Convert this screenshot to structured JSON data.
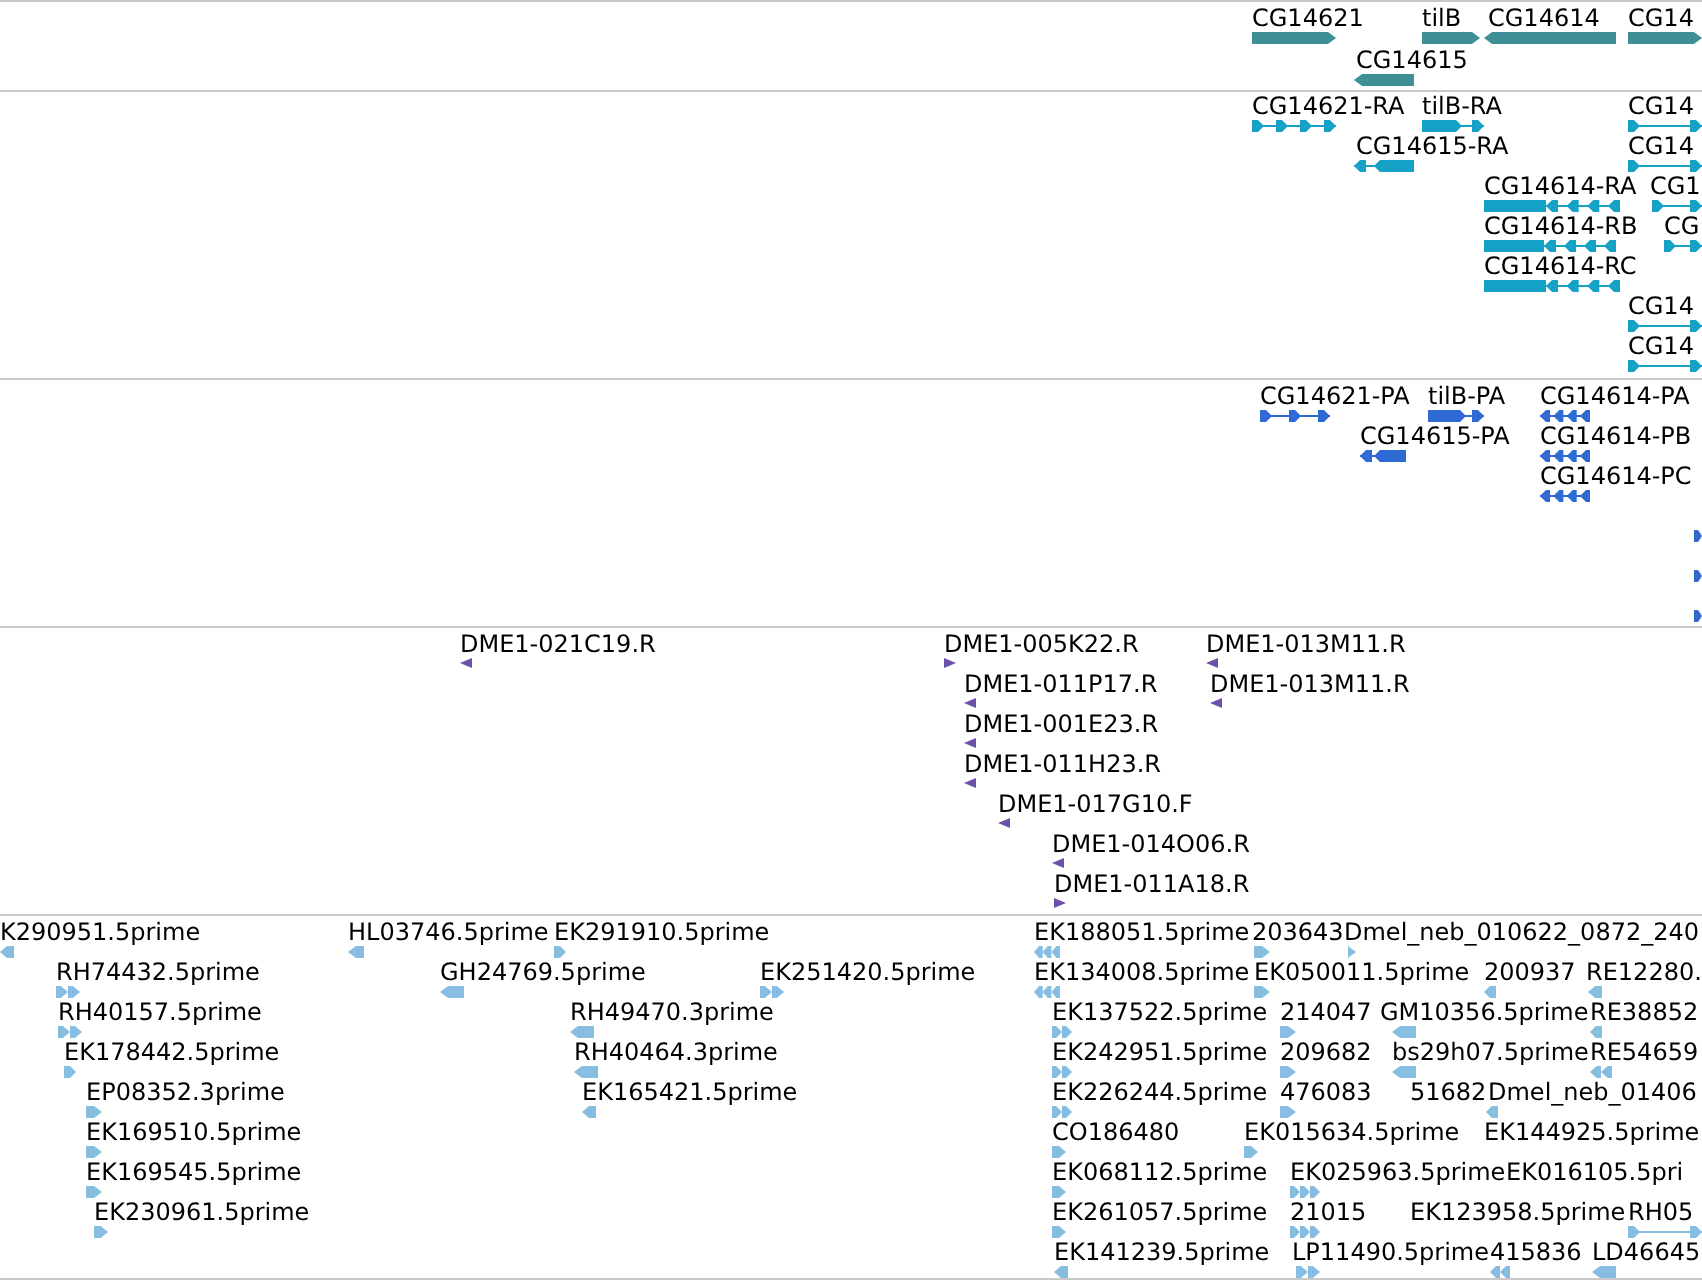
{
  "tracks": [
    {
      "kind": "gene",
      "features": [
        {
          "label": "CG14621",
          "reverse": false
        },
        {
          "label": "tilB",
          "reverse": false
        },
        {
          "label": "CG14614",
          "reverse": true
        },
        {
          "label": "CG14",
          "reverse": false
        },
        {
          "label": "CG14615",
          "reverse": true
        }
      ]
    },
    {
      "kind": "transcript",
      "features": [
        {
          "label": "CG14621-RA",
          "reverse": false
        },
        {
          "label": "tilB-RA",
          "reverse": false
        },
        {
          "label": "CG14",
          "reverse": false
        },
        {
          "label": "CG14615-RA",
          "reverse": true
        },
        {
          "label": "CG14",
          "reverse": false
        },
        {
          "label": "CG14614-RA",
          "reverse": true
        },
        {
          "label": "CG1",
          "reverse": false
        },
        {
          "label": "CG14614-RB",
          "reverse": true
        },
        {
          "label": "CG",
          "reverse": false
        },
        {
          "label": "CG14614-RC",
          "reverse": true
        },
        {
          "label": "CG14",
          "reverse": false
        },
        {
          "label": "CG14",
          "reverse": false
        }
      ]
    },
    {
      "kind": "protein",
      "features": [
        {
          "label": "CG14621-PA",
          "reverse": false
        },
        {
          "label": "tilB-PA",
          "reverse": false
        },
        {
          "label": "CG14614-PA",
          "reverse": true
        },
        {
          "label": "CG14615-PA",
          "reverse": true
        },
        {
          "label": "CG14614-PB",
          "reverse": true
        },
        {
          "label": "CG14614-PC",
          "reverse": true
        },
        {
          "reverse": false
        },
        {
          "reverse": false
        },
        {
          "reverse": false
        }
      ]
    },
    {
      "kind": "clone_end",
      "features": [
        {
          "label": "DME1-021C19.R",
          "reverse": true
        },
        {
          "label": "DME1-005K22.R",
          "reverse": false
        },
        {
          "label": "DME1-013M11.R",
          "reverse": true
        },
        {
          "label": "DME1-011P17.R",
          "reverse": true
        },
        {
          "label": "DME1-013M11.R",
          "reverse": true
        },
        {
          "label": "DME1-001E23.R",
          "reverse": true
        },
        {
          "label": "DME1-011H23.R",
          "reverse": true
        },
        {
          "label": "DME1-017G10.F",
          "reverse": true
        },
        {
          "label": "DME1-014O06.R",
          "reverse": true
        },
        {
          "label": "DME1-011A18.R",
          "reverse": false
        }
      ]
    },
    {
      "kind": "est",
      "features": [
        {
          "label": "K290951.5prime",
          "reverse": true
        },
        {
          "label": "HL03746.5prime",
          "reverse": true
        },
        {
          "label": "EK291910.5prime",
          "reverse": false
        },
        {
          "label": "EK188051.5prime",
          "reverse": true
        },
        {
          "label": "203643",
          "reverse": false
        },
        {
          "label": "Dmel_neb_010622_0872_240",
          "reverse": false
        },
        {
          "label": "RH74432.5prime",
          "reverse": false
        },
        {
          "label": "GH24769.5prime",
          "reverse": true
        },
        {
          "label": "EK251420.5prime",
          "reverse": false
        },
        {
          "label": "EK134008.5prime",
          "reverse": true
        },
        {
          "label": "EK050011.5prime",
          "reverse": false
        },
        {
          "label": "200937",
          "reverse": true
        },
        {
          "label": "RE12280.",
          "reverse": true
        },
        {
          "label": "RH40157.5prime",
          "reverse": false
        },
        {
          "label": "RH49470.3prime",
          "reverse": true
        },
        {
          "label": "EK137522.5prime",
          "reverse": false
        },
        {
          "label": "214047",
          "reverse": false
        },
        {
          "label": "GM10356.5prime",
          "reverse": true
        },
        {
          "label": "RE38852",
          "reverse": true
        },
        {
          "label": "EK178442.5prime",
          "reverse": false
        },
        {
          "label": "RH40464.3prime",
          "reverse": true
        },
        {
          "label": "EK242951.5prime",
          "reverse": false
        },
        {
          "label": "209682",
          "reverse": false
        },
        {
          "label": "bs29h07.5prime",
          "reverse": true
        },
        {
          "label": "RE54659",
          "reverse": true
        },
        {
          "label": "EP08352.3prime",
          "reverse": false
        },
        {
          "label": "EK165421.5prime",
          "reverse": true
        },
        {
          "label": "EK226244.5prime",
          "reverse": false
        },
        {
          "label": "476083",
          "reverse": false
        },
        {
          "label": "51682"
        },
        {
          "label": "Dmel_neb_01406",
          "reverse": true
        },
        {
          "label": "EK169510.5prime",
          "reverse": false
        },
        {
          "label": "CO186480",
          "reverse": false
        },
        {
          "label": "EK015634.5prime",
          "reverse": false
        },
        {
          "label": "EK144925.5prime"
        },
        {
          "label": "EK169545.5prime",
          "reverse": false
        },
        {
          "label": "EK068112.5prime",
          "reverse": false
        },
        {
          "label": "EK025963.5prime",
          "reverse": false
        },
        {
          "label": "EK016105.5pri"
        },
        {
          "label": "EK230961.5prime",
          "reverse": false
        },
        {
          "label": "EK261057.5prime",
          "reverse": false
        },
        {
          "label": "21015",
          "reverse": false
        },
        {
          "label": "EK123958.5prime"
        },
        {
          "label": "RH05",
          "reverse": false
        },
        {
          "label": "EK141239.5prime",
          "reverse": true
        },
        {
          "label": "LP11490.5prime",
          "reverse": false
        },
        {
          "label": "415836",
          "reverse": true
        },
        {
          "label": "LD46645",
          "reverse": true
        }
      ]
    }
  ]
}
